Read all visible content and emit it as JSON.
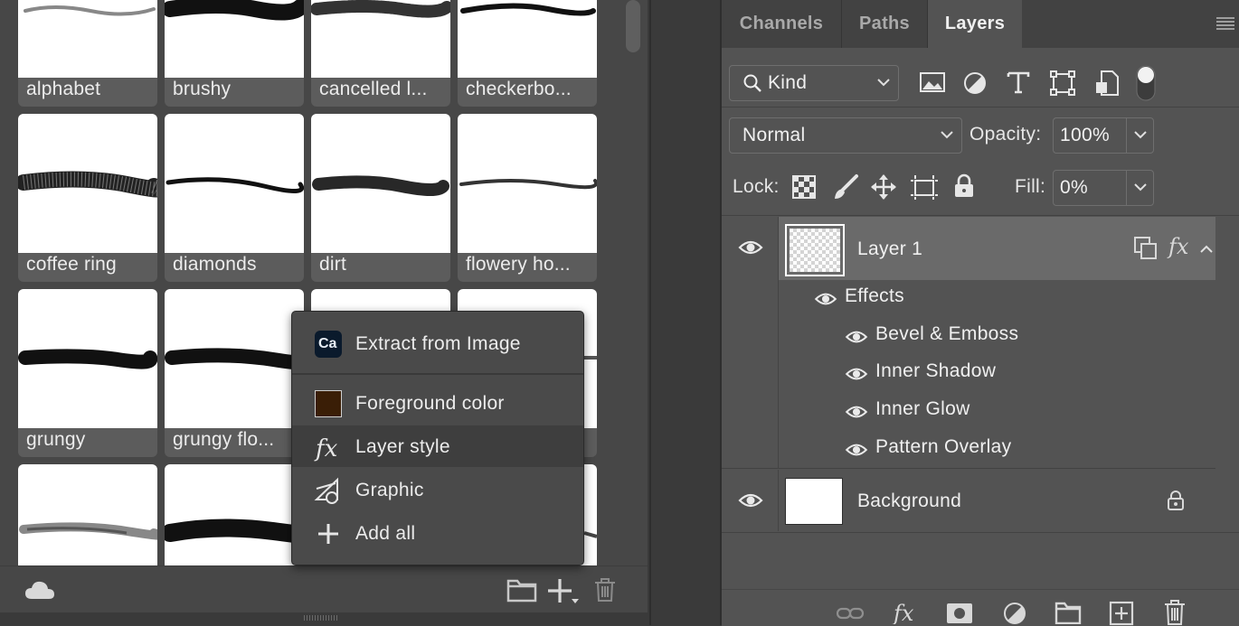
{
  "left_panel": {
    "brushes": [
      {
        "label": "alphabet"
      },
      {
        "label": "brushy"
      },
      {
        "label": "cancelled l..."
      },
      {
        "label": "checkerbo..."
      },
      {
        "label": "coffee ring"
      },
      {
        "label": "diamonds"
      },
      {
        "label": "dirt"
      },
      {
        "label": "flowery ho..."
      },
      {
        "label": "grungy"
      },
      {
        "label": "grungy flo..."
      },
      {
        "label": ""
      },
      {
        "label": ""
      },
      {
        "label": ""
      },
      {
        "label": ""
      },
      {
        "label": ""
      },
      {
        "label": ""
      }
    ],
    "footer_icons": [
      "cloud-icon",
      "folder-icon",
      "add-dropdown-icon",
      "trash-icon"
    ]
  },
  "context_menu": {
    "items": [
      {
        "label": "Extract from Image",
        "icon": "capture-app-icon"
      },
      {
        "label": "Foreground color",
        "icon": "color-swatch-icon",
        "swatch": "#3a1e06"
      },
      {
        "label": "Layer style",
        "icon": "fx-icon"
      },
      {
        "label": "Graphic",
        "icon": "graphic-icon"
      },
      {
        "label": "Add all",
        "icon": "plus-icon"
      }
    ],
    "capture_badge": "Ca"
  },
  "layers_panel": {
    "tabs": [
      {
        "label": "Channels"
      },
      {
        "label": "Paths"
      },
      {
        "label": "Layers"
      }
    ],
    "active_tab": "Layers",
    "filter": {
      "value": "Kind"
    },
    "blend_mode": {
      "value": "Normal"
    },
    "opacity": {
      "label": "Opacity:",
      "value": "100%"
    },
    "lock": {
      "label": "Lock:"
    },
    "fill": {
      "label": "Fill:",
      "value": "0%"
    },
    "layers": [
      {
        "name": "Layer 1",
        "effects_label": "Effects",
        "effects": [
          "Bevel & Emboss",
          "Inner Shadow",
          "Inner Glow",
          "Pattern Overlay"
        ],
        "fx_symbol": "fx"
      },
      {
        "name": "Background"
      }
    ],
    "bottom_icons": [
      "link-icon",
      "fx-icon",
      "mask-icon",
      "adjustment-icon",
      "group-folder-icon",
      "new-layer-icon",
      "delete-icon"
    ]
  },
  "colors": {
    "panel_bg": "#535353",
    "selected_layer": "#6a6a6a",
    "menu_bg": "#4a4a4a",
    "foreground_swatch": "#3a1e06"
  }
}
